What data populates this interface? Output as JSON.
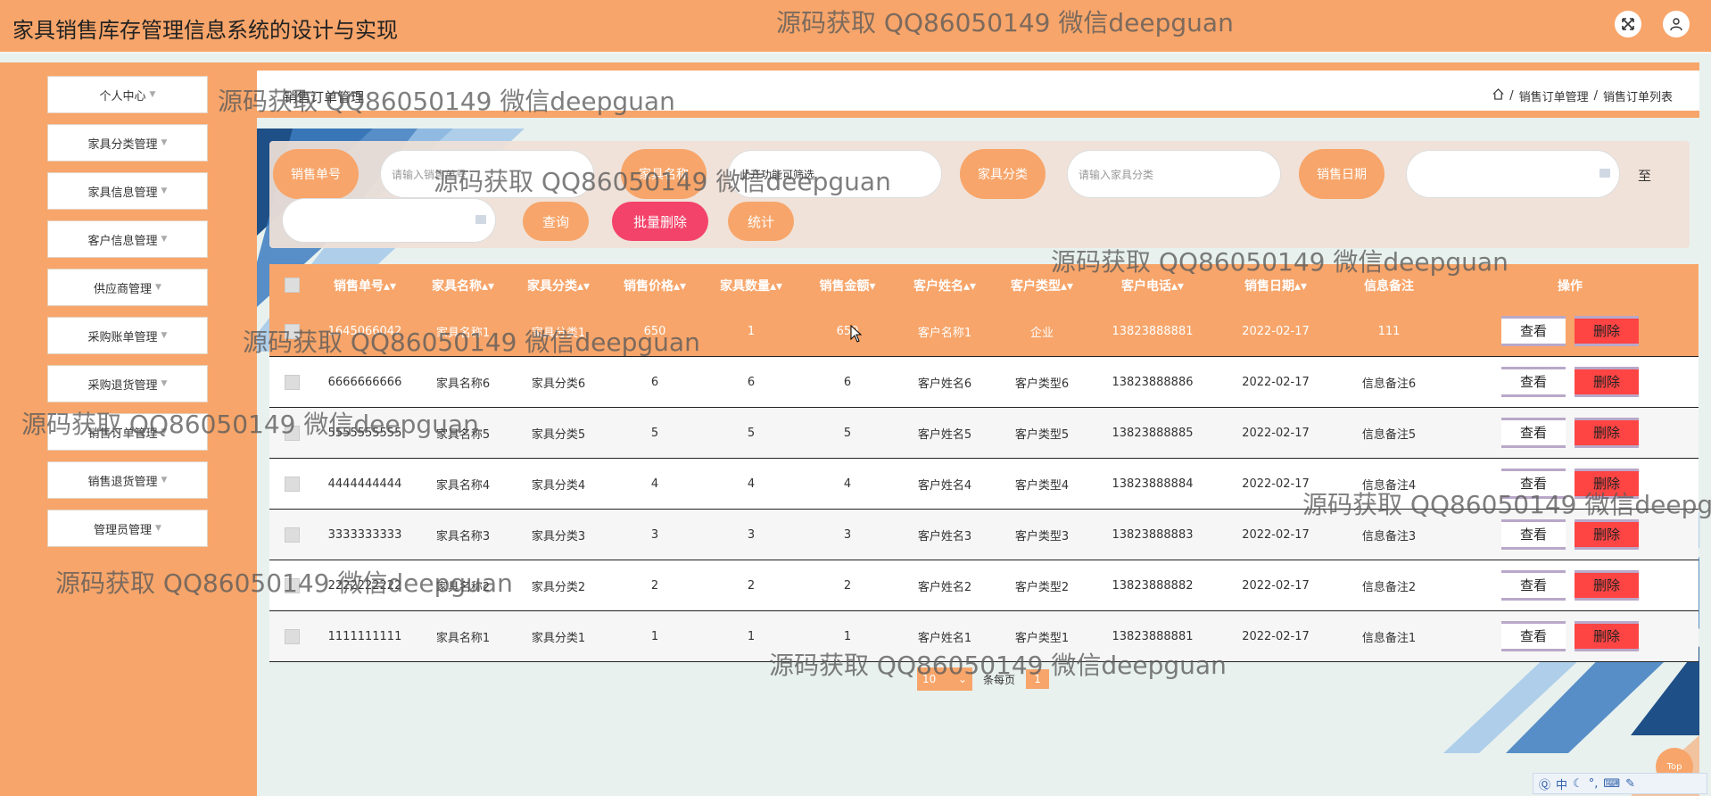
{
  "app": {
    "title": "家具销售库存管理信息系统的设计与实现"
  },
  "header_icons": [
    "fullscreen-icon",
    "user-icon"
  ],
  "sidebar": {
    "items": [
      {
        "label": "个人中心"
      },
      {
        "label": "家具分类管理"
      },
      {
        "label": "家具信息管理"
      },
      {
        "label": "客户信息管理"
      },
      {
        "label": "供应商管理"
      },
      {
        "label": "采购账单管理"
      },
      {
        "label": "采购退货管理"
      },
      {
        "label": "销售订单管理"
      },
      {
        "label": "销售退货管理"
      },
      {
        "label": "管理员管理"
      }
    ]
  },
  "page": {
    "heading": "销售订单管理",
    "breadcrumb": [
      "销售订单管理",
      "销售订单列表"
    ]
  },
  "filters": {
    "order_no_label": "销售单号",
    "order_no_placeholder": "请输入销售单号",
    "furniture_name_label": "家具名称",
    "furniture_name_value": "此开功能可筛选",
    "category_label": "家具分类",
    "category_placeholder": "请输入家具分类",
    "date_label": "销售日期",
    "date_to": "至",
    "query_btn": "查询",
    "batch_delete_btn": "批量删除",
    "stats_btn": "统计"
  },
  "table": {
    "columns": [
      "销售单号",
      "家具名称",
      "家具分类",
      "销售价格",
      "家具数量",
      "销售金额",
      "客户姓名",
      "客户类型",
      "客户电话",
      "销售日期",
      "信息备注",
      "操作"
    ],
    "view_label": "查看",
    "delete_label": "删除",
    "rows": [
      [
        "1645066042",
        "家具名称1",
        "家具分类1",
        "650",
        "1",
        "650",
        "客户名称1",
        "企业",
        "13823888881",
        "2022-02-17",
        "111"
      ],
      [
        "6666666666",
        "家具名称6",
        "家具分类6",
        "6",
        "6",
        "6",
        "客户姓名6",
        "客户类型6",
        "13823888886",
        "2022-02-17",
        "信息备注6"
      ],
      [
        "5555555555",
        "家具名称5",
        "家具分类5",
        "5",
        "5",
        "5",
        "客户姓名5",
        "客户类型5",
        "13823888885",
        "2022-02-17",
        "信息备注5"
      ],
      [
        "4444444444",
        "家具名称4",
        "家具分类4",
        "4",
        "4",
        "4",
        "客户姓名4",
        "客户类型4",
        "13823888884",
        "2022-02-17",
        "信息备注4"
      ],
      [
        "3333333333",
        "家具名称3",
        "家具分类3",
        "3",
        "3",
        "3",
        "客户姓名3",
        "客户类型3",
        "13823888883",
        "2022-02-17",
        "信息备注3"
      ],
      [
        "2222222222",
        "家具名称2",
        "家具分类2",
        "2",
        "2",
        "2",
        "客户姓名2",
        "客户类型2",
        "13823888882",
        "2022-02-17",
        "信息备注2"
      ],
      [
        "1111111111",
        "家具名称1",
        "家具分类1",
        "1",
        "1",
        "1",
        "客户姓名1",
        "客户类型1",
        "13823888881",
        "2022-02-17",
        "信息备注1"
      ]
    ]
  },
  "pagination": {
    "page_size": "10",
    "per_page_label": "条每页",
    "current_page": "1"
  },
  "watermark": "源码获取 QQ86050149 微信deepguan",
  "top_button": "Top",
  "ime": {
    "label": "中"
  },
  "colors": {
    "accent": "#f7a56a",
    "danger": "#f44444",
    "background": "#e8f1ee"
  }
}
